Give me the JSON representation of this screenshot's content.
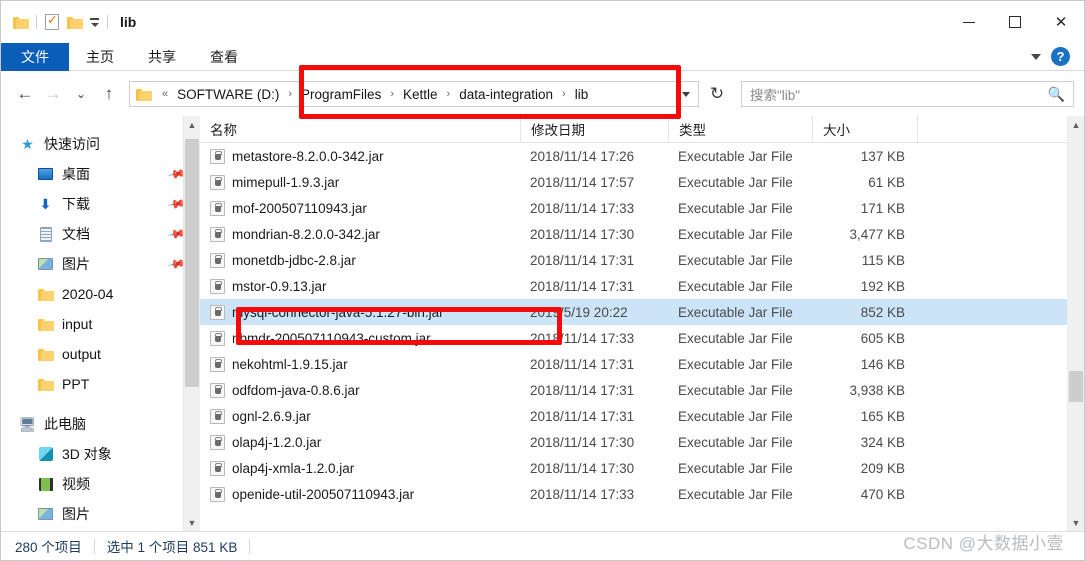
{
  "window": {
    "title": "lib",
    "quick_access": [
      "folder-icon",
      "properties-icon",
      "new-folder-icon",
      "customize-caret-icon"
    ],
    "controls": {
      "minimize": "—",
      "maximize": "□",
      "close": "✕"
    }
  },
  "ribbon": {
    "tabs": [
      {
        "label": "文件",
        "active": true
      },
      {
        "label": "主页",
        "active": false
      },
      {
        "label": "共享",
        "active": false
      },
      {
        "label": "查看",
        "active": false
      }
    ],
    "help_label": "?"
  },
  "address": {
    "back": "←",
    "forward": "→",
    "history": "⌄",
    "up": "↑",
    "root_sep": "«",
    "crumbs": [
      "SOFTWARE (D:)",
      "ProgramFiles",
      "Kettle",
      "data-integration",
      "lib"
    ],
    "separator": "›",
    "dropdown": "⌄",
    "refresh": "↻"
  },
  "search": {
    "placeholder": "搜索\"lib\"",
    "value": "",
    "icon": "search-icon"
  },
  "sidebar": {
    "groups": [
      {
        "header": {
          "label": "快速访问",
          "icon": "star-pin-icon"
        },
        "items": [
          {
            "label": "桌面",
            "icon": "desktop-icon",
            "pinned": true
          },
          {
            "label": "下载",
            "icon": "download-icon",
            "pinned": true
          },
          {
            "label": "文档",
            "icon": "documents-icon",
            "pinned": true
          },
          {
            "label": "图片",
            "icon": "pictures-icon",
            "pinned": true
          },
          {
            "label": "2020-04",
            "icon": "folder-icon",
            "pinned": false
          },
          {
            "label": "input",
            "icon": "folder-icon",
            "pinned": false
          },
          {
            "label": "output",
            "icon": "folder-icon",
            "pinned": false
          },
          {
            "label": "PPT",
            "icon": "folder-icon",
            "pinned": false
          }
        ]
      },
      {
        "header": {
          "label": "此电脑",
          "icon": "this-pc-icon"
        },
        "items": [
          {
            "label": "3D 对象",
            "icon": "3d-objects-icon",
            "pinned": false
          },
          {
            "label": "视频",
            "icon": "videos-icon",
            "pinned": false
          },
          {
            "label": "图片",
            "icon": "pictures-icon",
            "pinned": false
          }
        ]
      }
    ]
  },
  "filelist": {
    "columns": [
      "名称",
      "修改日期",
      "类型",
      "大小"
    ],
    "rows": [
      {
        "name": "metastore-8.2.0.0-342.jar",
        "date": "2018/11/14 17:26",
        "type": "Executable Jar File",
        "size": "137 KB",
        "selected": false
      },
      {
        "name": "mimepull-1.9.3.jar",
        "date": "2018/11/14 17:57",
        "type": "Executable Jar File",
        "size": "61 KB",
        "selected": false
      },
      {
        "name": "mof-200507110943.jar",
        "date": "2018/11/14 17:33",
        "type": "Executable Jar File",
        "size": "171 KB",
        "selected": false
      },
      {
        "name": "mondrian-8.2.0.0-342.jar",
        "date": "2018/11/14 17:30",
        "type": "Executable Jar File",
        "size": "3,477 KB",
        "selected": false
      },
      {
        "name": "monetdb-jdbc-2.8.jar",
        "date": "2018/11/14 17:31",
        "type": "Executable Jar File",
        "size": "115 KB",
        "selected": false
      },
      {
        "name": "mstor-0.9.13.jar",
        "date": "2018/11/14 17:31",
        "type": "Executable Jar File",
        "size": "192 KB",
        "selected": false
      },
      {
        "name": "mysql-connector-java-5.1.27-bin.jar",
        "date": "2019/5/19 20:22",
        "type": "Executable Jar File",
        "size": "852 KB",
        "selected": true
      },
      {
        "name": "nbmdr-200507110943-custom.jar",
        "date": "2018/11/14 17:33",
        "type": "Executable Jar File",
        "size": "605 KB",
        "selected": false
      },
      {
        "name": "nekohtml-1.9.15.jar",
        "date": "2018/11/14 17:31",
        "type": "Executable Jar File",
        "size": "146 KB",
        "selected": false
      },
      {
        "name": "odfdom-java-0.8.6.jar",
        "date": "2018/11/14 17:31",
        "type": "Executable Jar File",
        "size": "3,938 KB",
        "selected": false
      },
      {
        "name": "ognl-2.6.9.jar",
        "date": "2018/11/14 17:31",
        "type": "Executable Jar File",
        "size": "165 KB",
        "selected": false
      },
      {
        "name": "olap4j-1.2.0.jar",
        "date": "2018/11/14 17:30",
        "type": "Executable Jar File",
        "size": "324 KB",
        "selected": false
      },
      {
        "name": "olap4j-xmla-1.2.0.jar",
        "date": "2018/11/14 17:30",
        "type": "Executable Jar File",
        "size": "209 KB",
        "selected": false
      },
      {
        "name": "openide-util-200507110943.jar",
        "date": "2018/11/14 17:33",
        "type": "Executable Jar File",
        "size": "470 KB",
        "selected": false
      }
    ]
  },
  "statusbar": {
    "item_count": "280 个项目",
    "selection": "选中 1 个项目  851 KB"
  },
  "annotations": {
    "accent_color": "#f40c0c",
    "boxes": [
      {
        "name": "breadcrumb-highlight"
      },
      {
        "name": "selected-file-highlight"
      }
    ]
  },
  "watermark": {
    "text": "CSDN @大数据小壹"
  }
}
